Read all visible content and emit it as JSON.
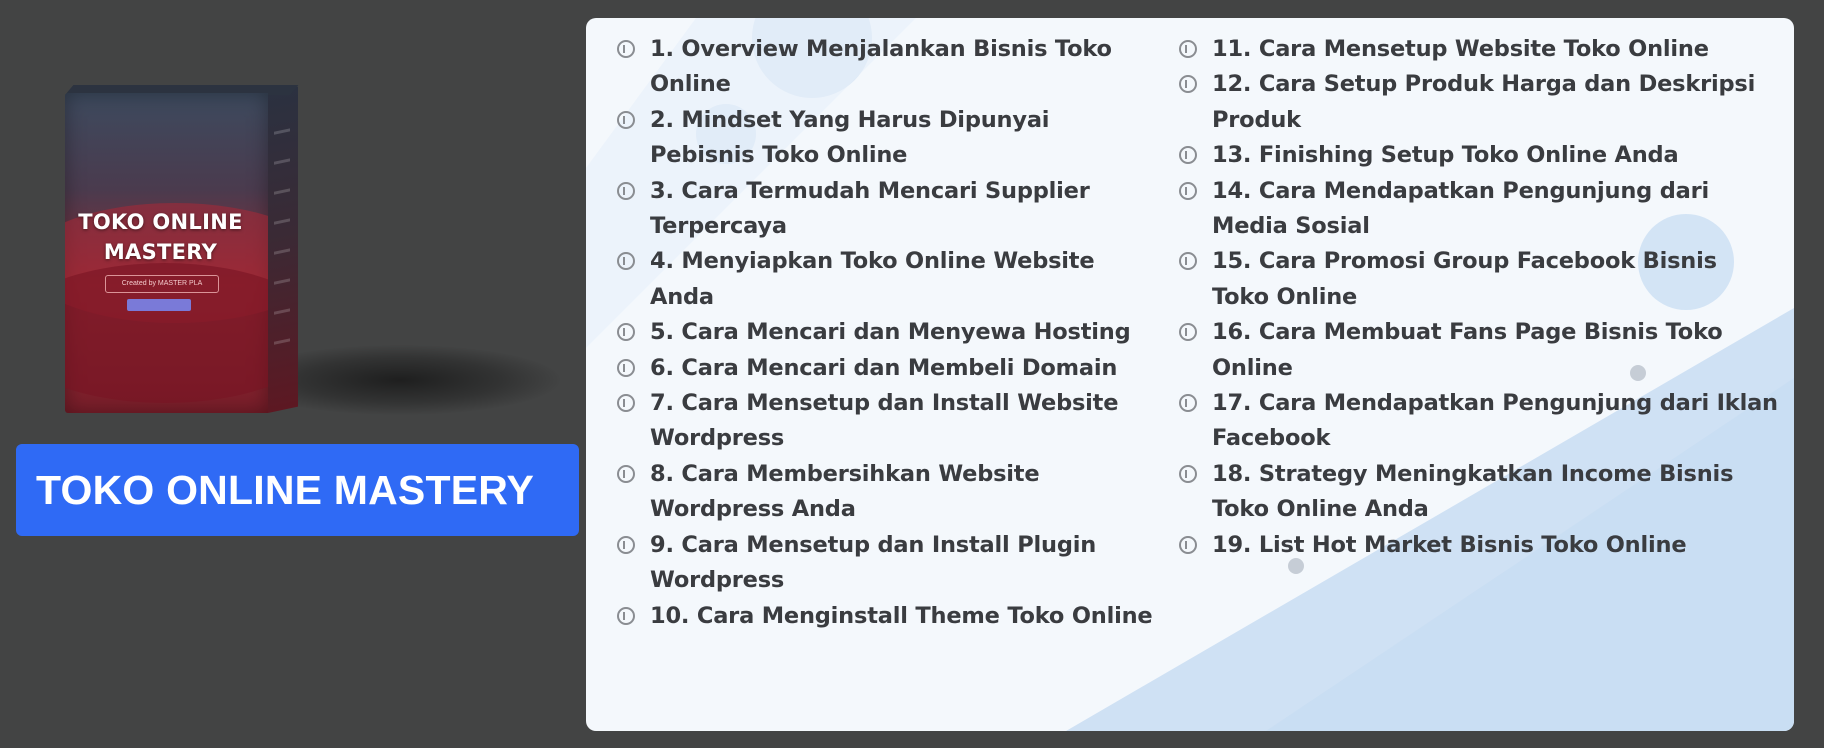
{
  "product": {
    "box_title_line1": "TOKO ONLINE",
    "box_title_line2": "MASTERY",
    "box_created_by": "Created by MASTER PLA",
    "banner_title": "TOKO ONLINE MASTERY"
  },
  "curriculum": {
    "left": [
      {
        "line1": "1. Overview Menjalankan Bisnis Toko",
        "line2": "Online"
      },
      {
        "line1": "2. Mindset Yang Harus Dipunyai",
        "line2": "Pebisnis Toko Online"
      },
      {
        "line1": "3. Cara Termudah Mencari Supplier",
        "line2": "Terpercaya"
      },
      {
        "line1": "4. Menyiapkan Toko Online Website",
        "line2": "Anda"
      },
      {
        "line1": "5. Cara Mencari dan Menyewa Hosting",
        "line2": ""
      },
      {
        "line1": "6. Cara Mencari dan Membeli Domain",
        "line2": ""
      },
      {
        "line1": "7. Cara Mensetup dan Install Website",
        "line2": "Wordpress"
      },
      {
        "line1": "8. Cara Membersihkan Website",
        "line2": "Wordpress Anda"
      },
      {
        "line1": "9. Cara Mensetup dan Install Plugin",
        "line2": "Wordpress"
      },
      {
        "line1": "10. Cara Menginstall Theme Toko Online",
        "line2": ""
      }
    ],
    "right": [
      {
        "line1": "11. Cara Mensetup Website Toko Online",
        "line2": ""
      },
      {
        "line1": "12. Cara Setup Produk Harga dan Deskripsi",
        "line2": "Produk"
      },
      {
        "line1": "13. Finishing Setup Toko Online Anda",
        "line2": ""
      },
      {
        "line1": "14. Cara Mendapatkan Pengunjung dari",
        "line2": "Media Sosial"
      },
      {
        "line1": "15. Cara Promosi Group Facebook Bisnis",
        "line2": "Toko Online"
      },
      {
        "line1": "16. Cara Membuat Fans Page Bisnis Toko",
        "line2": "Online"
      },
      {
        "line1": "17. Cara Mendapatkan Pengunjung dari Iklan",
        "line2": "Facebook"
      },
      {
        "line1": "18. Strategy Meningkatkan Income Bisnis",
        "line2": "Toko Online Anda"
      },
      {
        "line1": "19. List Hot Market Bisnis Toko Online",
        "line2": ""
      }
    ]
  },
  "icons": {
    "lesson": "play-circle-icon"
  },
  "colors": {
    "page_background": "#434444",
    "banner": "#2f6af5",
    "card_background": "#f4f8fc",
    "text": "#3a3c40"
  }
}
